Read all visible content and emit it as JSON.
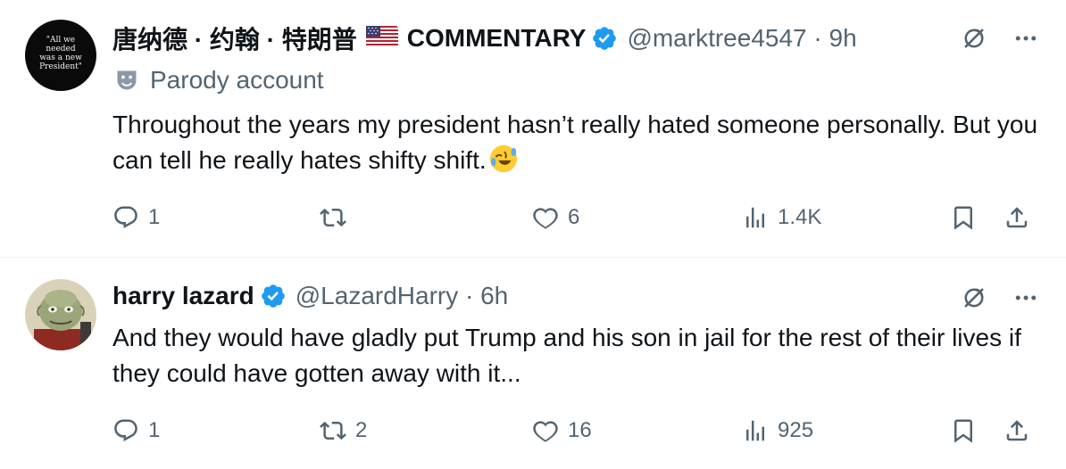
{
  "tweets": [
    {
      "avatar_text": [
        "\"All we",
        "needed",
        "was a new",
        "President\""
      ],
      "display_name": "唐纳德 · 约翰 · 特朗普",
      "display_name_suffix": "COMMENTARY",
      "flag_icon": "us-flag-icon",
      "handle": "@marktree4547 · 9h",
      "parody_label": "Parody account",
      "text": "Throughout the years my president hasn’t really hated someone personally. But you can tell he really hates shifty shift.",
      "emoji": "rolling-on-floor-laughing-emoji",
      "stats": {
        "replies": "1",
        "reposts": "",
        "likes": "6",
        "views": "1.4K"
      }
    },
    {
      "display_name": "harry lazard",
      "handle": "@LazardHarry · 6h",
      "text": "And they would have gladly put Trump and his son in jail for the rest of their lives if they could have gotten away with it...",
      "stats": {
        "replies": "1",
        "reposts": "2",
        "likes": "16",
        "views": "925"
      }
    }
  ],
  "colors": {
    "verified": "#1d9bf0",
    "secondary_text": "#536471",
    "primary_text": "#0f1419"
  }
}
